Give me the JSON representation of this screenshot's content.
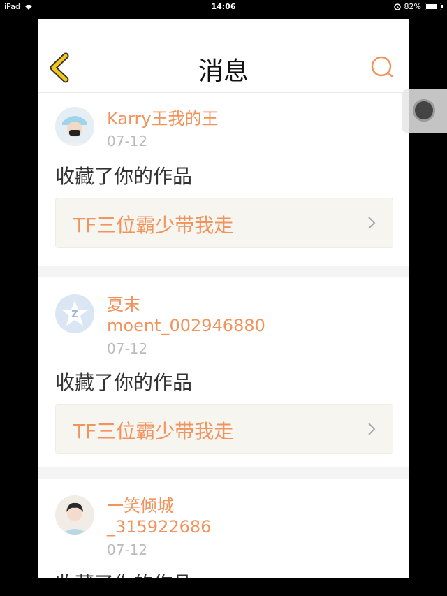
{
  "status_bar": {
    "device": "iPad",
    "time": "14:06",
    "battery": "82%",
    "battery_level": 0.82
  },
  "nav": {
    "title": "消息",
    "back_icon": "chevron-left-icon",
    "search_icon": "search-icon"
  },
  "notifications": [
    {
      "name": "Karry王我的王",
      "date": "07-12",
      "action": "收藏了你的作品",
      "work_title": "TF三位霸少带我走"
    },
    {
      "name_line1": "夏末",
      "name_line2": "moent_002946880",
      "date": "07-12",
      "action": "收藏了你的作品",
      "work_title": "TF三位霸少带我走"
    },
    {
      "name_line1": "一笑倾城",
      "name_line2": "_315922686",
      "date": "07-12",
      "action": "收藏了你的作品"
    }
  ],
  "colors": {
    "accent": "#f0935d",
    "back_icon": "#f5c518",
    "date": "#bbbbbb",
    "work_bg": "#f6f5ef"
  }
}
